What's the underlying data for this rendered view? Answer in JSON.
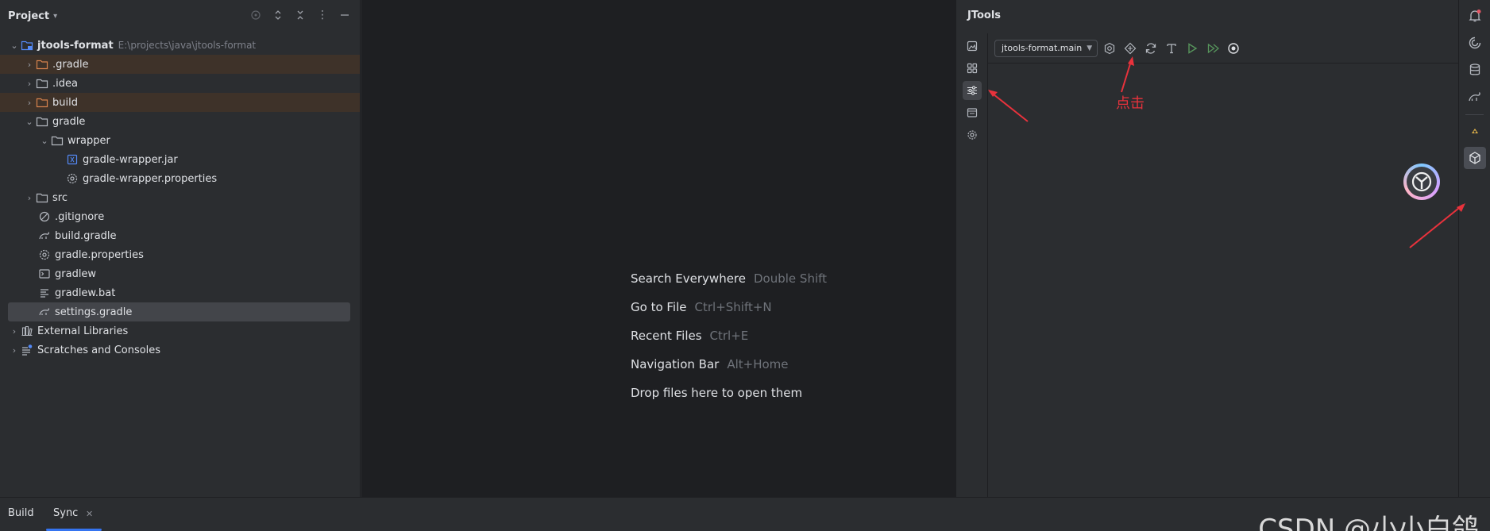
{
  "project_panel": {
    "title": "Project",
    "tree": [
      {
        "label": "jtools-format",
        "path": "E:\\projects\\java\\jtools-format",
        "depth": 0,
        "expanded": true,
        "icon": "module-folder-icon",
        "excluded": false
      },
      {
        "label": ".gradle",
        "depth": 1,
        "expanded": false,
        "icon": "folder-excluded-icon",
        "excluded": true
      },
      {
        "label": ".idea",
        "depth": 1,
        "expanded": false,
        "icon": "folder-icon",
        "excluded": false
      },
      {
        "label": "build",
        "depth": 1,
        "expanded": false,
        "icon": "folder-excluded-icon",
        "excluded": true
      },
      {
        "label": "gradle",
        "depth": 1,
        "expanded": true,
        "icon": "folder-icon",
        "excluded": false
      },
      {
        "label": "wrapper",
        "depth": 2,
        "expanded": true,
        "icon": "folder-icon",
        "excluded": false
      },
      {
        "label": "gradle-wrapper.jar",
        "depth": 3,
        "icon": "jar-icon"
      },
      {
        "label": "gradle-wrapper.properties",
        "depth": 3,
        "icon": "properties-icon"
      },
      {
        "label": "src",
        "depth": 1,
        "expanded": false,
        "icon": "folder-icon"
      },
      {
        "label": ".gitignore",
        "depth": 1,
        "icon": "gitignore-icon"
      },
      {
        "label": "build.gradle",
        "depth": 1,
        "icon": "gradle-icon"
      },
      {
        "label": "gradle.properties",
        "depth": 1,
        "icon": "properties-icon"
      },
      {
        "label": "gradlew",
        "depth": 1,
        "icon": "terminal-file-icon"
      },
      {
        "label": "gradlew.bat",
        "depth": 1,
        "icon": "text-file-icon"
      },
      {
        "label": "settings.gradle",
        "depth": 1,
        "icon": "gradle-icon",
        "selected": true
      },
      {
        "label": "External Libraries",
        "depth": 0,
        "expanded": false,
        "icon": "libraries-icon"
      },
      {
        "label": "Scratches and Consoles",
        "depth": 0,
        "expanded": false,
        "icon": "scratches-icon"
      }
    ]
  },
  "editor": {
    "hints": [
      {
        "action": "Search Everywhere",
        "key": "Double Shift"
      },
      {
        "action": "Go to File",
        "key": "Ctrl+Shift+N"
      },
      {
        "action": "Recent Files",
        "key": "Ctrl+E"
      },
      {
        "action": "Navigation Bar",
        "key": "Alt+Home"
      },
      {
        "action": "Drop files here to open them",
        "key": ""
      }
    ]
  },
  "jtools": {
    "title": "JTools",
    "module_select": "jtools-format.main",
    "annotation": "点击"
  },
  "bottom_bar": {
    "tab_build": "Build",
    "tab_sync": "Sync",
    "watermark": "CSDN @小小白鸽"
  },
  "colors": {
    "accent": "#3574f0",
    "annotation_red": "#e8323c",
    "run_green": "#57965c"
  }
}
